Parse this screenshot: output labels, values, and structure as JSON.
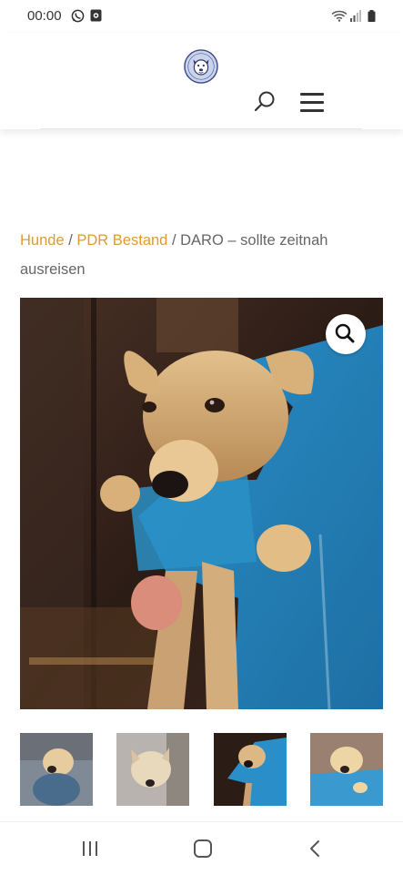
{
  "status_bar": {
    "time": "00:00",
    "left_icons": [
      "whatsapp-icon",
      "notification-icon"
    ],
    "right_icons": [
      "wifi-icon",
      "signal-icon",
      "battery-icon"
    ]
  },
  "header": {
    "logo": "dog-logo",
    "search_icon": "search-icon",
    "menu_icon": "hamburger-menu-icon"
  },
  "breadcrumb": {
    "items": [
      {
        "label": "Hunde",
        "link": true
      },
      {
        "label": "PDR Bestand",
        "link": true
      }
    ],
    "separator": " / ",
    "current": "DARO – sollte zeitnah ausreisen",
    "link_color": "#e09a2f"
  },
  "gallery": {
    "zoom_icon": "magnifier-icon",
    "thumbnail_count": 4
  },
  "nav_bar": {
    "icons": [
      "recent-apps-icon",
      "home-icon",
      "back-icon"
    ]
  }
}
